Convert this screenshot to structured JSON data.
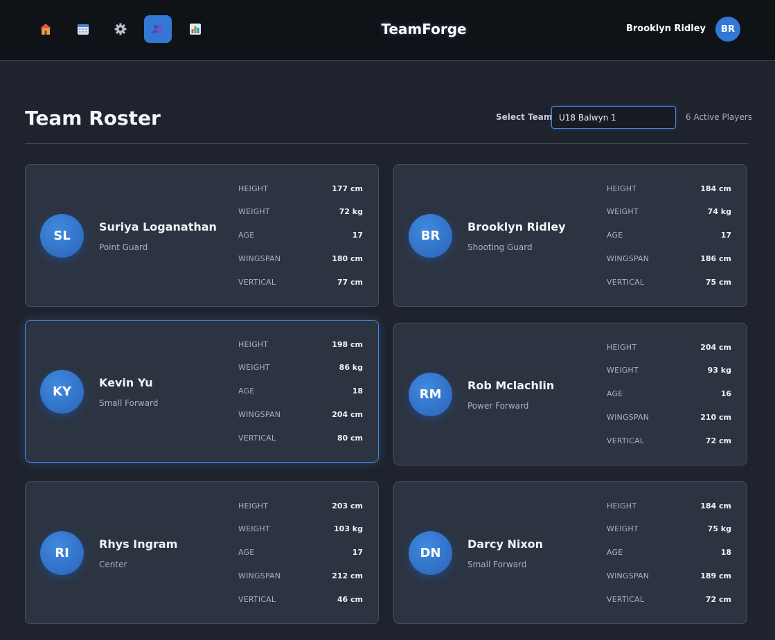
{
  "app": {
    "title": "TeamForge",
    "user_name": "Brooklyn Ridley",
    "user_initials": "BR",
    "accent_color": "#3478d6"
  },
  "nav": [
    {
      "icon": "home-icon"
    },
    {
      "icon": "calendar-icon"
    },
    {
      "icon": "gear-icon"
    },
    {
      "icon": "team-icon",
      "active": true
    },
    {
      "icon": "bar-chart-icon"
    }
  ],
  "page": {
    "title": "Team Roster",
    "select_label": "Select Team:",
    "selected_team": "U18 Balwyn 1",
    "active_players": "6 Active Players"
  },
  "stat_labels": [
    "HEIGHT",
    "WEIGHT",
    "AGE",
    "WINGSPAN",
    "VERTICAL"
  ],
  "players": [
    {
      "initials": "SL",
      "name": "Suriya Loganathan",
      "position": "Point Guard",
      "stats": [
        "177 cm",
        "72 kg",
        "17",
        "180 cm",
        "77 cm"
      ]
    },
    {
      "initials": "BR",
      "name": "Brooklyn Ridley",
      "position": "Shooting Guard",
      "stats": [
        "184 cm",
        "74 kg",
        "17",
        "186 cm",
        "75 cm"
      ]
    },
    {
      "initials": "KY",
      "name": "Kevin Yu",
      "position": "Small Forward",
      "stats": [
        "198 cm",
        "86 kg",
        "18",
        "204 cm",
        "80 cm"
      ],
      "selected": true
    },
    {
      "initials": "RM",
      "name": "Rob Mclachlin",
      "position": "Power Forward",
      "stats": [
        "204 cm",
        "93 kg",
        "16",
        "210 cm",
        "72 cm"
      ]
    },
    {
      "initials": "RI",
      "name": "Rhys Ingram",
      "position": "Center",
      "stats": [
        "203 cm",
        "103 kg",
        "17",
        "212 cm",
        "46 cm"
      ]
    },
    {
      "initials": "DN",
      "name": "Darcy Nixon",
      "position": "Small Forward",
      "stats": [
        "184 cm",
        "75 kg",
        "18",
        "189 cm",
        "72 cm"
      ]
    }
  ]
}
